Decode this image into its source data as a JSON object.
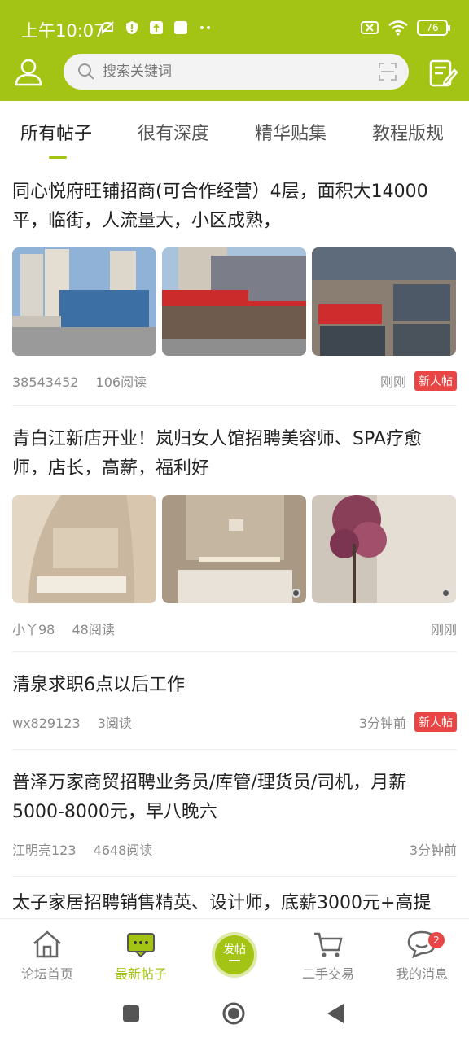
{
  "status_bar": {
    "time": "上午10:07",
    "battery": "76"
  },
  "search": {
    "placeholder": "搜索关键词"
  },
  "tabs": [
    {
      "label": "所有帖子",
      "active": true
    },
    {
      "label": "很有深度",
      "active": false
    },
    {
      "label": "精华贴集",
      "active": false
    },
    {
      "label": "教程版规",
      "active": false
    }
  ],
  "posts": [
    {
      "title": "同心悦府旺铺招商(可合作经营）4层，面积大14000平，临街，人流量大，小区成熟，",
      "author": "38543452",
      "reads": "106阅读",
      "time": "刚刚",
      "badge": "新人帖"
    },
    {
      "title": "青白江新店开业！岚归女人馆招聘美容师、SPA疗愈师，店长，高薪，福利好",
      "author": "小丫98",
      "reads": "48阅读",
      "time": "刚刚",
      "badge": ""
    },
    {
      "title": "清泉求职6点以后工作",
      "author": "wx829123",
      "reads": "3阅读",
      "time": "3分钟前",
      "badge": "新人帖"
    },
    {
      "title": "普泽万家商贸招聘业务员/库管/理货员/司机，月薪5000-8000元，早八晚六",
      "author": "江明亮123",
      "reads": "4648阅读",
      "time": "3分钟前",
      "badge": ""
    },
    {
      "title": "太子家居招聘销售精英、设计师，底薪3000元+高提"
    }
  ],
  "bottom_nav": {
    "home": "论坛首页",
    "latest": "最新帖子",
    "post": "发帖",
    "trade": "二手交易",
    "messages": "我的消息",
    "message_count": "2"
  },
  "colors": {
    "accent": "#a3c414",
    "badge": "#ea4545"
  }
}
